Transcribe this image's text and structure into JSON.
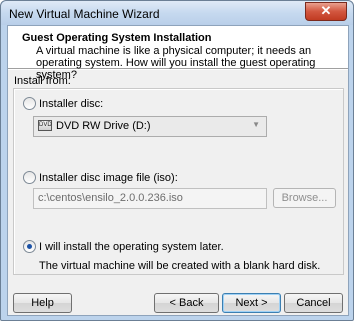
{
  "window": {
    "title": "New Virtual Machine Wizard"
  },
  "titlebar": {
    "close_glyph": "✕"
  },
  "header": {
    "title": "Guest Operating System Installation",
    "description": "A virtual machine is like a physical computer; it needs an operating system. How will you install the guest operating system?"
  },
  "install_from": {
    "label": "Install from:",
    "options": [
      {
        "label": "Installer disc:",
        "selected": false
      },
      {
        "label": "Installer disc image file (iso):",
        "selected": false
      },
      {
        "label": "I will install the operating system later.",
        "selected": true
      }
    ],
    "disc_drive": {
      "value": "DVD RW Drive (D:)",
      "icon": "dvd-drive-icon"
    },
    "iso_path": {
      "value": "c:\\centos\\ensilo_2.0.0.236.iso"
    },
    "browse_label": "Browse...",
    "later_note": "The virtual machine will be created with a blank hard disk."
  },
  "footer": {
    "help_label": "Help",
    "back_label": "< Back",
    "next_label": "Next >",
    "cancel_label": "Cancel"
  }
}
